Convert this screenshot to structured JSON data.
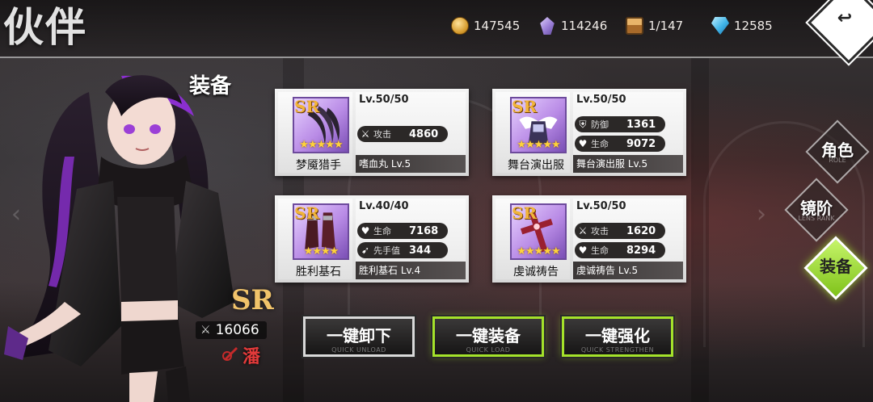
{
  "header": {
    "title": "伙伴",
    "resources": [
      {
        "icon": "gold-coin-icon",
        "value": "147545"
      },
      {
        "icon": "crystal-icon",
        "value": "114246"
      },
      {
        "icon": "chest-icon",
        "value": "1/147"
      },
      {
        "icon": "diamond-icon",
        "value": "12585"
      }
    ]
  },
  "character": {
    "rarity": "SR",
    "power": "16066",
    "faction": "潘"
  },
  "section_title": "装备",
  "equipment": [
    {
      "rarity": "SR",
      "stars": "★★★★★",
      "name": "梦魇猎手",
      "level": "Lv.50/50",
      "stats": [
        {
          "icon": "sword-icon",
          "label": "攻击",
          "value": "4860"
        }
      ],
      "sub_name": "嗜血丸 Lv.5"
    },
    {
      "rarity": "SR",
      "stars": "★★★★★",
      "name": "舞台演出服",
      "level": "Lv.50/50",
      "stats": [
        {
          "icon": "shield-icon",
          "label": "防御",
          "value": "1361"
        },
        {
          "icon": "heart-icon",
          "label": "生命",
          "value": "9072"
        }
      ],
      "sub_name": "舞台演出服 Lv.5"
    },
    {
      "rarity": "SR",
      "stars": "★★★★",
      "name": "胜利基石",
      "level": "Lv.40/40",
      "stats": [
        {
          "icon": "heart-icon",
          "label": "生命",
          "value": "7168"
        },
        {
          "icon": "boot-icon",
          "label": "先手值",
          "value": "344"
        }
      ],
      "sub_name": "胜利基石 Lv.4"
    },
    {
      "rarity": "SR",
      "stars": "★★★★★",
      "name": "虔诚祷告",
      "level": "Lv.50/50",
      "stats": [
        {
          "icon": "sword-icon",
          "label": "攻击",
          "value": "1620"
        },
        {
          "icon": "heart-icon",
          "label": "生命",
          "value": "8294"
        }
      ],
      "sub_name": "虔诚祷告 Lv.5"
    }
  ],
  "actions": [
    {
      "label": "一键卸下",
      "sub": "QUICK UNLOAD",
      "style": "gray"
    },
    {
      "label": "一键装备",
      "sub": "QUICK LOAD",
      "style": "green"
    },
    {
      "label": "一键强化",
      "sub": "QUICK STRENGTHEN",
      "style": "green"
    }
  ],
  "nav": [
    {
      "label": "角色",
      "sub": "ROLE",
      "active": false
    },
    {
      "label": "镜阶",
      "sub": "LENS RANK",
      "active": false
    },
    {
      "label": "装备",
      "sub": "",
      "active": true
    }
  ],
  "colors": {
    "accent_green": "#a4e22a",
    "gold": "#f1c36a",
    "faction_red": "#e23a3a"
  }
}
